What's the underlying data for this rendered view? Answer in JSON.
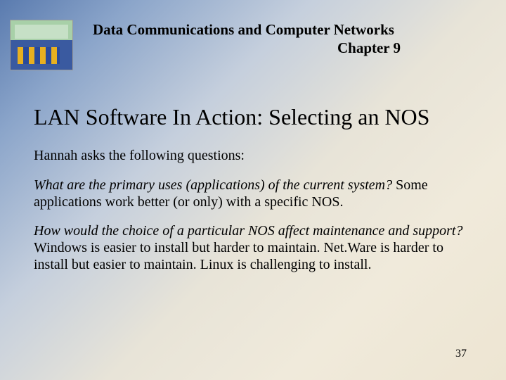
{
  "header": {
    "course_title": "Data Communications and Computer Networks",
    "chapter": "Chapter 9"
  },
  "slide": {
    "title": "LAN Software In Action: Selecting an NOS",
    "lead": "Hannah asks the following questions:",
    "q1": "What are the primary uses (applications) of the current system?",
    "a1": "  Some applications work better (or only) with a specific NOS.",
    "q2": "How would the choice of a particular NOS affect maintenance and support?",
    "a2": "  Windows is easier to install but harder to maintain. Net.Ware is harder to install but easier to maintain. Linux is challenging to install."
  },
  "page_number": "37"
}
